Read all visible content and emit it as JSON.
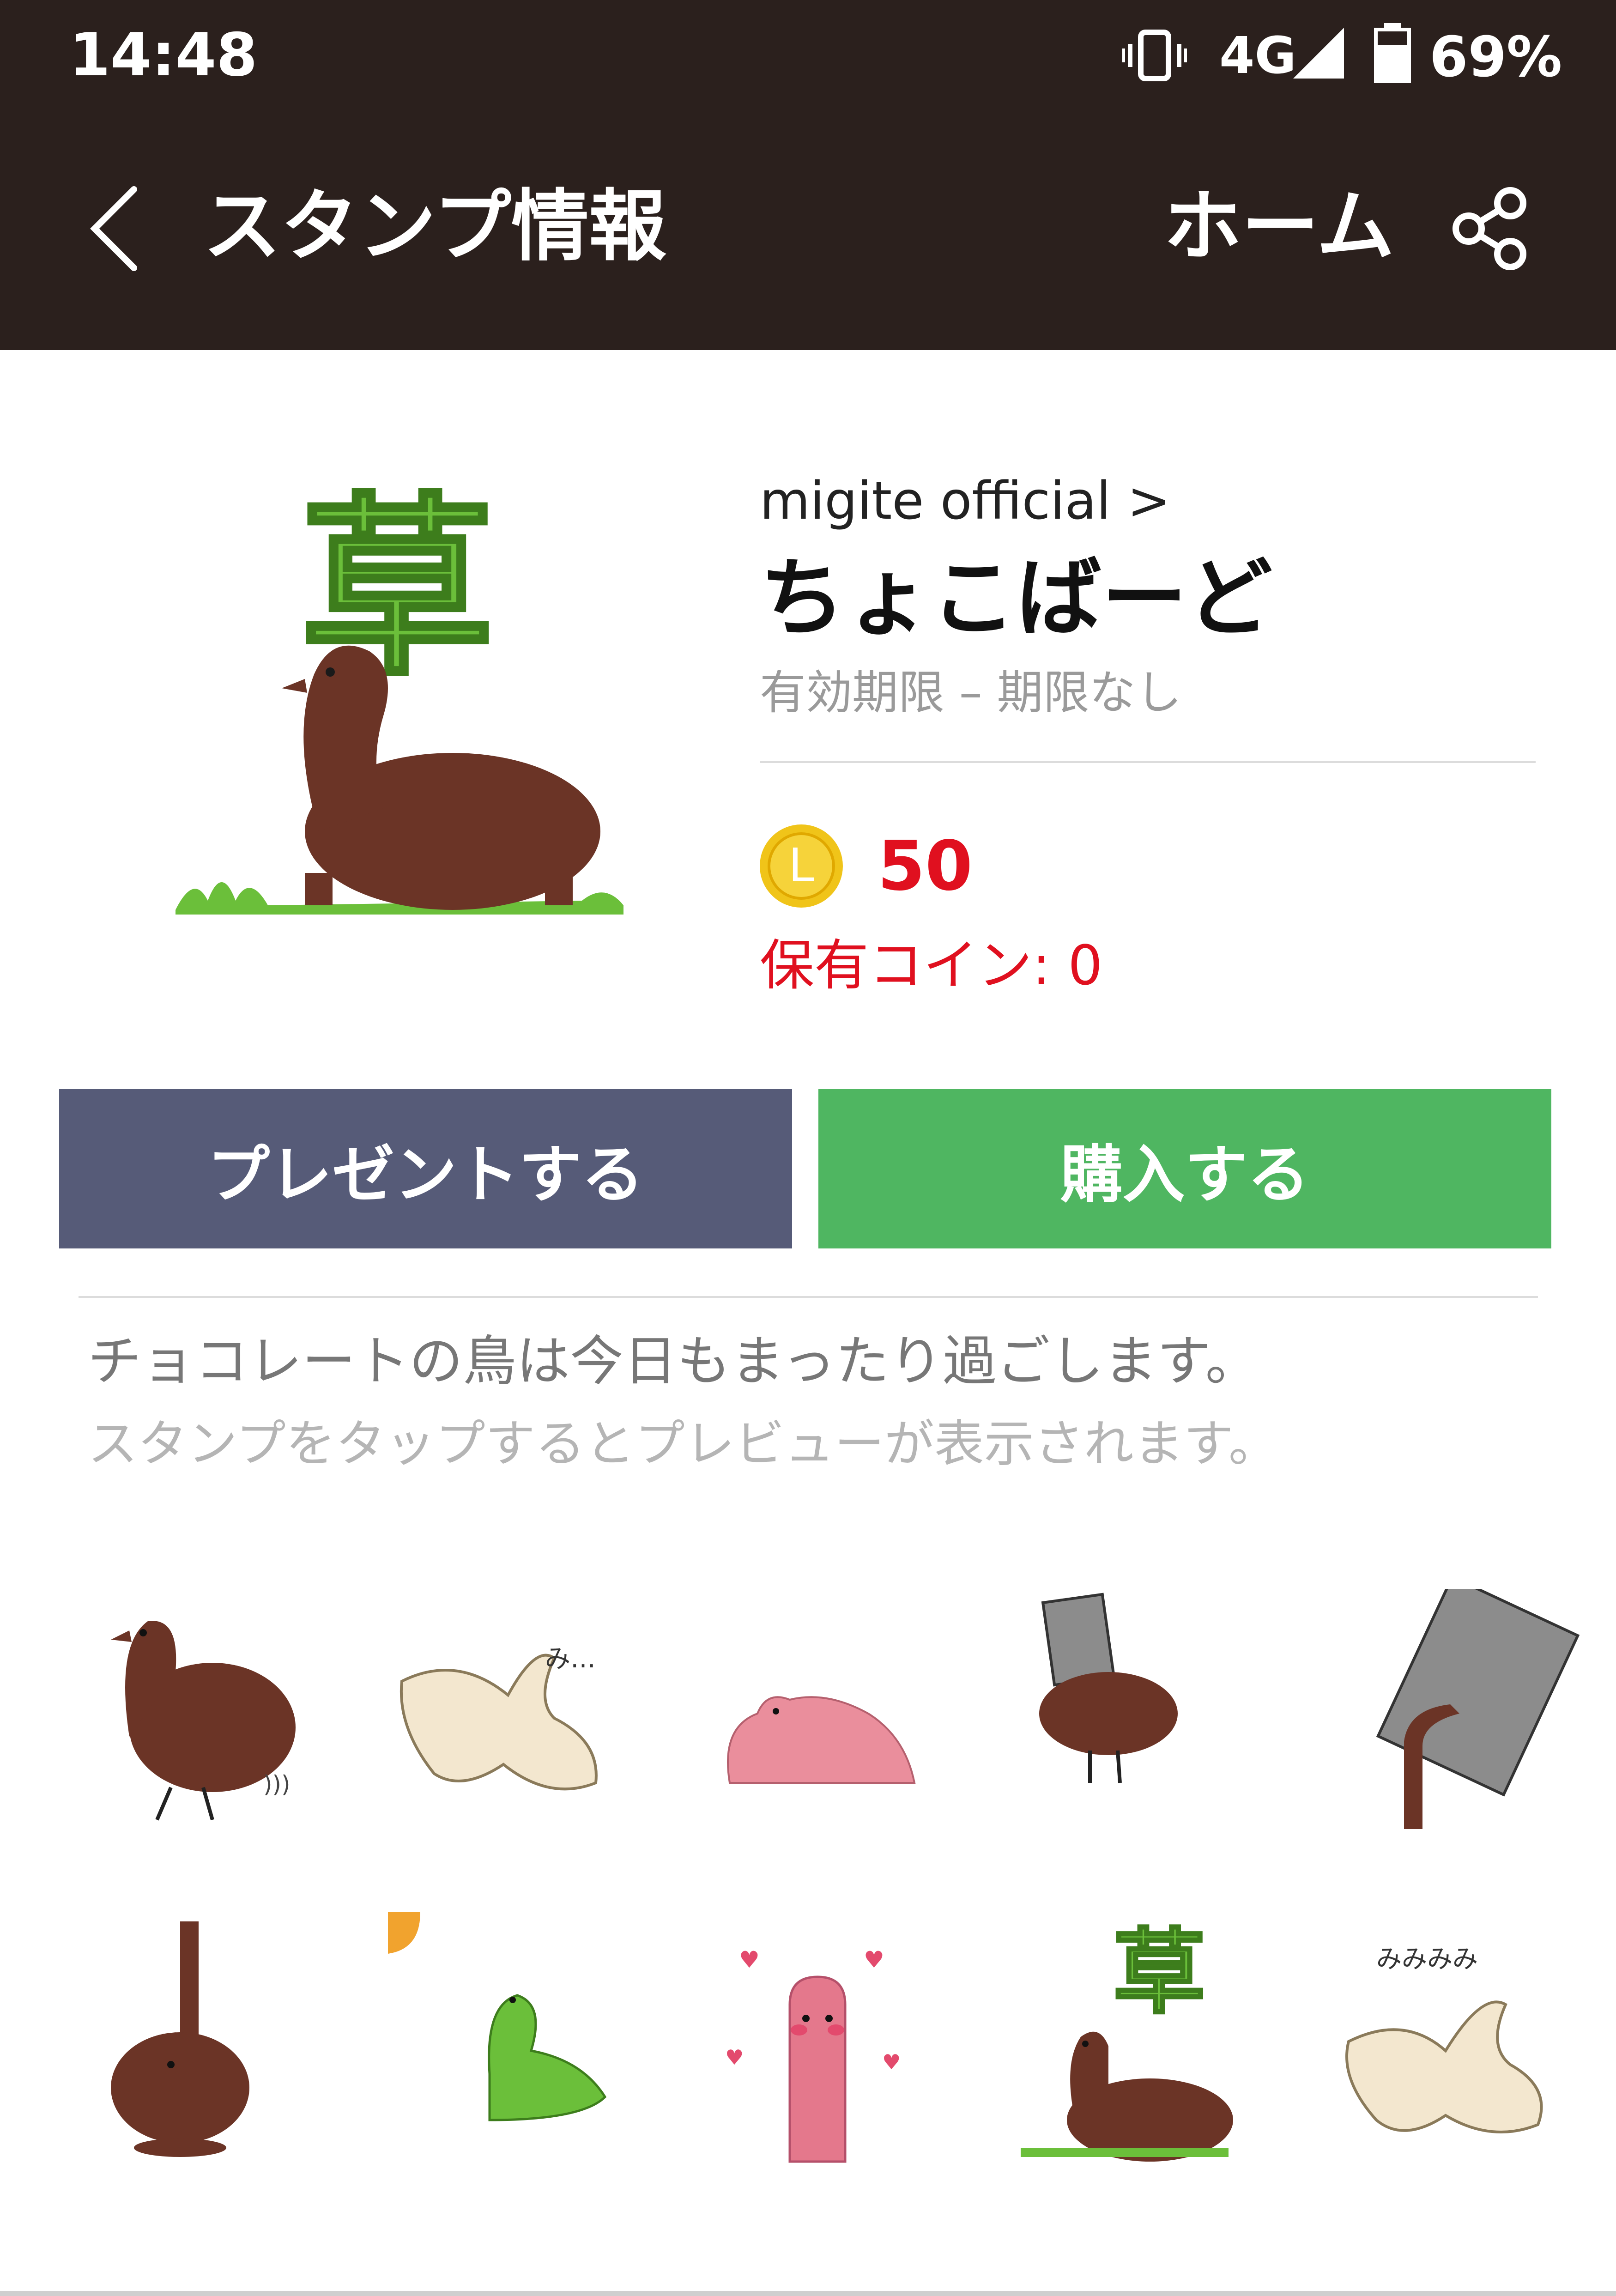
{
  "status_bar": {
    "time": "14:48",
    "network": "4G",
    "battery": "69%"
  },
  "app_bar": {
    "title": "スタンプ情報",
    "home": "ホーム"
  },
  "sticker": {
    "author": "migite official >",
    "name": "ちょこばーど",
    "validity": "有効期限 – 期限なし",
    "coin_symbol": "L",
    "price": "50",
    "owned_coins": "保有コイン: 0"
  },
  "actions": {
    "present": "プレゼントする",
    "buy": "購入する"
  },
  "description": "チョコレートの鳥は今日もまったり過ごします。",
  "hint": "スタンプをタップするとプレビューが表示されます。",
  "stickers_text": {
    "mi": "み…",
    "mimimimi": "みみみみ",
    "kusa": "草"
  },
  "colors": {
    "bar": "#2b201d",
    "present": "#565b78",
    "buy": "#4fb661",
    "price": "#e0101f",
    "chocolate": "#6b3426",
    "grass": "#6bbf3a"
  }
}
